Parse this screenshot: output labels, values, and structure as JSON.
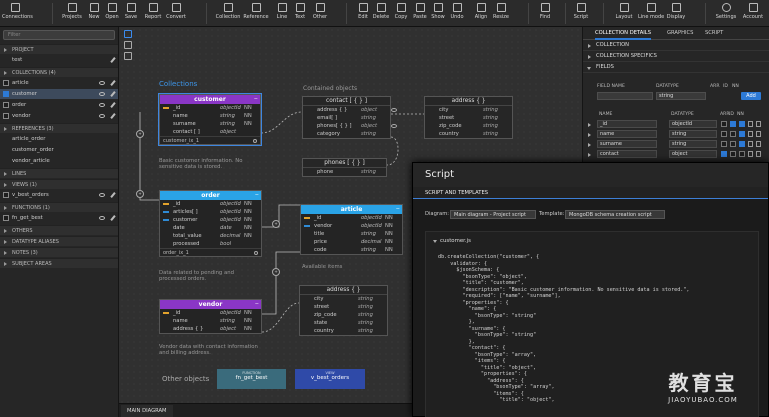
{
  "toolbar": {
    "buttons": [
      {
        "label": "Connections",
        "icon": "plug-icon"
      },
      {
        "label": "Projects",
        "icon": "folder-icon"
      },
      {
        "label": "New",
        "icon": "new-file-icon"
      },
      {
        "label": "Open",
        "icon": "open-folder-icon"
      },
      {
        "label": "Save",
        "icon": "save-icon"
      },
      {
        "label": "Report",
        "icon": "report-icon"
      },
      {
        "label": "Convert",
        "icon": "convert-icon"
      },
      {
        "label": "Collection",
        "icon": "collection-icon"
      },
      {
        "label": "Reference",
        "icon": "reference-icon"
      },
      {
        "label": "Line",
        "icon": "line-icon"
      },
      {
        "label": "Text",
        "icon": "text-icon"
      },
      {
        "label": "Other",
        "icon": "other-icon"
      },
      {
        "label": "Edit",
        "icon": "edit-icon"
      },
      {
        "label": "Delete",
        "icon": "delete-icon"
      },
      {
        "label": "Copy",
        "icon": "copy-icon"
      },
      {
        "label": "Paste",
        "icon": "paste-icon"
      },
      {
        "label": "Show",
        "icon": "eye-icon"
      },
      {
        "label": "Undo",
        "icon": "undo-icon"
      },
      {
        "label": "Align",
        "icon": "align-icon"
      },
      {
        "label": "Resize",
        "icon": "resize-icon"
      },
      {
        "label": "Find",
        "icon": "search-icon"
      },
      {
        "label": "Script",
        "icon": "script-icon"
      },
      {
        "label": "Layout",
        "icon": "layout-icon"
      },
      {
        "label": "Line mode",
        "icon": "line-mode-icon"
      },
      {
        "label": "Display",
        "icon": "display-icon"
      },
      {
        "label": "Settings",
        "icon": "gear-icon"
      },
      {
        "label": "Account",
        "icon": "user-icon"
      }
    ]
  },
  "left": {
    "filter_placeholder": "Filter",
    "project_head": "PROJECT",
    "project_name": "test",
    "collections_head": "COLLECTIONS",
    "collections_count": "(4)",
    "collections": [
      "article",
      "customer",
      "order",
      "vendor"
    ],
    "references_head": "REFERENCES",
    "references_count": "(3)",
    "references": [
      "article_order",
      "customer_order",
      "vendor_article"
    ],
    "lines_head": "LINES",
    "views_head": "VIEWS",
    "views_count": "(1)",
    "views": [
      "v_best_orders"
    ],
    "functions_head": "FUNCTIONS",
    "functions_count": "(1)",
    "functions": [
      "fn_get_best"
    ],
    "others_head": "OTHERS",
    "aliases_head": "DATATYPE ALIASES",
    "notes_head": "NOTES",
    "notes_count": "(3)",
    "subject_head": "SUBJECT AREAS"
  },
  "canvas": {
    "group_collections": "Collections",
    "group_contained": "Contained objects",
    "customer": {
      "title": "customer",
      "rows": [
        {
          "name": "_id",
          "type": "objectId",
          "flag": "NN"
        },
        {
          "name": "name",
          "type": "string",
          "flag": "NN"
        },
        {
          "name": "surname",
          "type": "string",
          "flag": "NN"
        },
        {
          "name": "contact [ ]",
          "type": "object",
          "flag": ""
        }
      ],
      "footer": "customer_ix_1",
      "note": "Basic customer information. No sensitive data is stored."
    },
    "order": {
      "title": "order",
      "rows": [
        {
          "name": "_id",
          "type": "objectId",
          "flag": "NN"
        },
        {
          "name": "articles[ ]",
          "type": "objectId",
          "flag": "NN"
        },
        {
          "name": "customer",
          "type": "objectId",
          "flag": "NN"
        },
        {
          "name": "date",
          "type": "date",
          "flag": "NN"
        },
        {
          "name": "total_value",
          "type": "decimal",
          "flag": "NN"
        },
        {
          "name": "processed",
          "type": "bool",
          "flag": ""
        }
      ],
      "footer": "order_ix_1",
      "note": "Data related to pending and processed orders."
    },
    "article": {
      "title": "article",
      "rows": [
        {
          "name": "_id",
          "type": "objectId",
          "flag": "NN"
        },
        {
          "name": "vendor",
          "type": "objectId",
          "flag": "NN"
        },
        {
          "name": "title",
          "type": "string",
          "flag": "NN"
        },
        {
          "name": "price",
          "type": "decimal",
          "flag": "NN"
        },
        {
          "name": "code",
          "type": "string",
          "flag": "NN"
        }
      ],
      "note": "Available items"
    },
    "vendor": {
      "title": "vendor",
      "rows": [
        {
          "name": "_id",
          "type": "objectId",
          "flag": "NN"
        },
        {
          "name": "name",
          "type": "string",
          "flag": "NN"
        },
        {
          "name": "address { }",
          "type": "object",
          "flag": "NN"
        }
      ],
      "note": "Vendor data with contact information and billing address."
    },
    "contact": {
      "title": "contact [ { } ]",
      "rows": [
        {
          "name": "address { }",
          "type": "object"
        },
        {
          "name": "email[ ]",
          "type": "string"
        },
        {
          "name": "phones[ { } ]",
          "type": "object"
        },
        {
          "name": "category",
          "type": "string"
        }
      ]
    },
    "address1": {
      "title": "address { }",
      "rows": [
        {
          "name": "city",
          "type": "string"
        },
        {
          "name": "street",
          "type": "string"
        },
        {
          "name": "zip_code",
          "type": "string"
        },
        {
          "name": "country",
          "type": "string"
        }
      ]
    },
    "phones": {
      "title": "phones [ { } ]",
      "rows": [
        {
          "name": "phone",
          "type": "string"
        }
      ]
    },
    "address2": {
      "title": "address { }",
      "rows": [
        {
          "name": "city",
          "type": "string"
        },
        {
          "name": "street",
          "type": "string"
        },
        {
          "name": "zip_code",
          "type": "string"
        },
        {
          "name": "state",
          "type": "string"
        },
        {
          "name": "country",
          "type": "string"
        }
      ]
    },
    "other_objects": "Other objects",
    "function_cap": "FUNCTION",
    "function_name": "fn_get_best",
    "view_cap": "VIEW",
    "view_name": "v_best_orders",
    "main_tab": "MAIN DIAGRAM"
  },
  "right": {
    "tabs": [
      "COLLECTION DETAILS",
      "GRAPHICS",
      "SCRIPT"
    ],
    "sections": [
      "COLLECTION",
      "COLLECTION SPECIFICS",
      "FIELDS"
    ],
    "new_field_header": "FIELD NAME",
    "datatype_header": "DATATYPE",
    "arr_header": "ARR",
    "id_header": "ID",
    "nn_header": "NN",
    "new_datatype_value": "string",
    "add_label": "Add",
    "table_name_header": "NAME",
    "table_datatype_header": "DATATYPE",
    "fields": [
      {
        "name": "_id",
        "type": "objectId",
        "arr": false,
        "id": true,
        "nn": true
      },
      {
        "name": "name",
        "type": "string",
        "arr": false,
        "id": false,
        "nn": true
      },
      {
        "name": "surname",
        "type": "string",
        "arr": false,
        "id": false,
        "nn": true
      },
      {
        "name": "contact",
        "type": "object",
        "arr": true,
        "id": false,
        "nn": false
      }
    ]
  },
  "script": {
    "title": "Script",
    "tab": "SCRIPT AND TEMPLATES",
    "diagram_label": "Diagram:",
    "diagram_value": "Main diagram - Project script",
    "template_label": "Template:",
    "template_value": "MongoDB schema creation script",
    "file": "customer.js",
    "code": [
      "db.createCollection(\"customer\", {",
      "    validator: {",
      "      $jsonSchema: {",
      "        \"bsonType\": \"object\",",
      "        \"title\": \"customer\",",
      "        \"description\": \"Basic customer information. No sensitive data is stored.\",",
      "        \"required\": [\"name\", \"surname\"],",
      "        \"properties\": {",
      "          \"name\": {",
      "            \"bsonType\": \"string\"",
      "          },",
      "          \"surname\": {",
      "            \"bsonType\": \"string\"",
      "          },",
      "          \"contact\": {",
      "            \"bsonType\": \"array\",",
      "            \"items\": {",
      "              \"title\": \"object\",",
      "              \"properties\": {",
      "                \"address\": {",
      "                  \"bsonType\": \"array\",",
      "                  \"items\": {",
      "                    \"title\": \"object\","
    ]
  },
  "watermark": {
    "big": "教育宝",
    "small": "JIAOYUBAO.COM"
  },
  "colors": {
    "customer": "#8a36c6",
    "order": "#2aa3e6",
    "article": "#2aa3e6",
    "vendor": "#8a36c6",
    "accent": "#2d7ad6",
    "function_box": "#3a6b7c",
    "view_box": "#2f4aa8"
  }
}
